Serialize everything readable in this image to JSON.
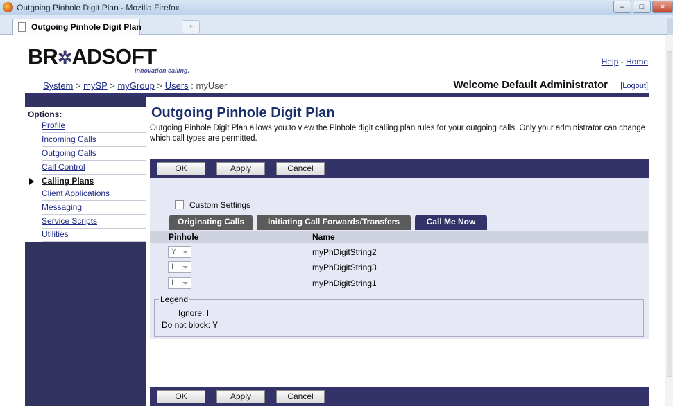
{
  "window": {
    "title": "Outgoing Pinhole Digit Plan - Mozilla Firefox",
    "tab_label": "Outgoing Pinhole Digit Plan",
    "new_tab": "+"
  },
  "header": {
    "logo_text": "BR",
    "logo_star": "✲",
    "logo_text2": "ADSOFT",
    "tagline": "Innovation calling.",
    "help": "Help",
    "separator": "-",
    "home": "Home",
    "breadcrumb": {
      "system": "System",
      "sep": " > ",
      "sp": "mySP",
      "group": "myGroup",
      "users": "Users",
      "colon": " : ",
      "user": "myUser"
    },
    "welcome": "Welcome Default Administrator",
    "logout": "[Logout]"
  },
  "sidebar": {
    "title": "Options:",
    "items": [
      {
        "label": "Profile"
      },
      {
        "label": "Incoming Calls"
      },
      {
        "label": "Outgoing Calls"
      },
      {
        "label": "Call Control"
      },
      {
        "label": "Calling Plans"
      },
      {
        "label": "Client Applications"
      },
      {
        "label": "Messaging"
      },
      {
        "label": "Service Scripts"
      },
      {
        "label": "Utilities"
      }
    ],
    "active_index": 4
  },
  "main": {
    "title": "Outgoing Pinhole Digit Plan",
    "description": "Outgoing Pinhole Digit Plan allows you to view the Pinhole digit calling plan rules for your outgoing calls. Only your administrator can change which call types are permitted.",
    "buttons": {
      "ok": "OK",
      "apply": "Apply",
      "cancel": "Cancel"
    },
    "custom_settings": "Custom Settings",
    "custom_settings_checked": false,
    "tabs": [
      {
        "label": "Originating Calls"
      },
      {
        "label": "Initiating Call Forwards/Transfers"
      },
      {
        "label": "Call Me Now"
      }
    ],
    "active_tab": 2,
    "columns": {
      "pinhole": "Pinhole",
      "name": "Name"
    },
    "rows": [
      {
        "pinhole": "Y",
        "name": "myPhDigitString2"
      },
      {
        "pinhole": "I",
        "name": "myPhDigitString3"
      },
      {
        "pinhole": "I",
        "name": "myPhDigitString1"
      }
    ],
    "legend": {
      "title": "Legend",
      "ignore": "Ignore: I",
      "do_not_block": "Do not block: Y"
    }
  },
  "colors": {
    "nav_bar": "#33336a",
    "panel_bg": "#e6e8f5",
    "link": "#1f2a86",
    "title": "#1a2f6a"
  }
}
